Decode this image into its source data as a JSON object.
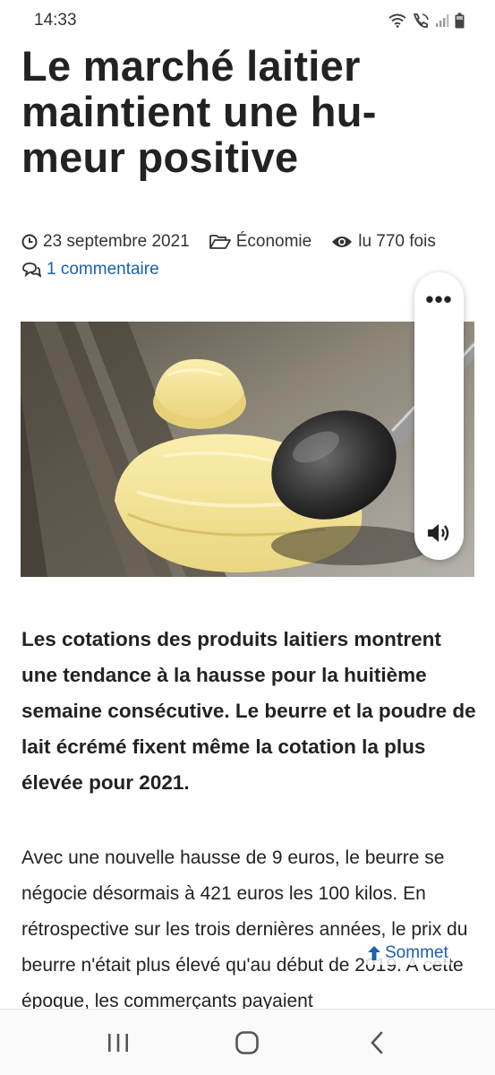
{
  "status_bar": {
    "time": "14:33",
    "icons": [
      "wifi-icon",
      "call-icon",
      "signal-icon",
      "battery-icon"
    ]
  },
  "article": {
    "title": "Le marché laitier maintient une hu-meur positive",
    "date": "23 septembre 2021",
    "category": "Économie",
    "views": "lu 770 fois",
    "comments": "1 commentaire",
    "lead": "Les cotations des produits laitiers montrent une tendance à la hausse pour la huitième semaine consécutive. Le beurre et la poudre de lait écrémé fixent même la cotation la plus élevée pour 2021.",
    "body": "Avec une nouvelle hausse de 9 euros, le beurre se négocie désormais à 421 euros les 100 kilos. En rétrospective sur les trois dernières années, le prix du beurre n'était plus élevé qu'au début de 2019. A cette époque, les commerçants payaient"
  },
  "floating_panel": {
    "menu_label": "•••",
    "icons": [
      "more-icon",
      "speaker-icon"
    ]
  },
  "back_to_top": {
    "label": "Sommet"
  },
  "nav_bar": {
    "buttons": [
      "recent-apps-icon",
      "home-icon",
      "back-icon"
    ]
  },
  "colors": {
    "link": "#1a5fb0",
    "text": "#222222",
    "background": "#ffffff"
  }
}
